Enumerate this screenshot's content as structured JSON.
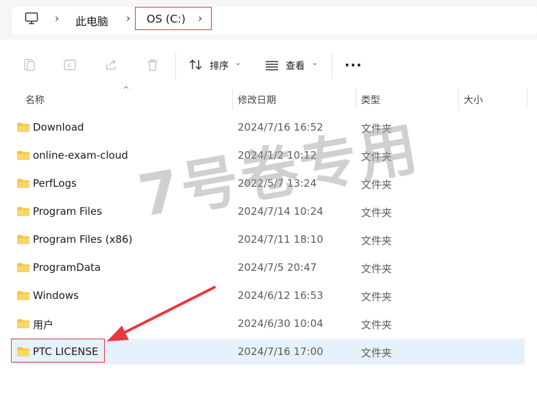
{
  "address_bar": {
    "icon": "computer-icon",
    "crumbs": [
      "此电脑",
      "OS (C:)"
    ],
    "highlight_color": "#d9363e"
  },
  "toolbar": {
    "sort_label": "排序",
    "view_label": "查看",
    "more_label": "..."
  },
  "columns": {
    "name": "名称",
    "date": "修改日期",
    "type": "类型",
    "size": "大小"
  },
  "rows": [
    {
      "name": "Download",
      "date": "2024/7/16 16:52",
      "type": "文件夹"
    },
    {
      "name": "online-exam-cloud",
      "date": "2024/1/2 10:12",
      "type": "文件夹"
    },
    {
      "name": "PerfLogs",
      "date": "2022/5/7 13:24",
      "type": "文件夹"
    },
    {
      "name": "Program Files",
      "date": "2024/7/14 10:24",
      "type": "文件夹"
    },
    {
      "name": "Program Files (x86)",
      "date": "2024/7/11 18:10",
      "type": "文件夹"
    },
    {
      "name": "ProgramData",
      "date": "2024/7/5 20:47",
      "type": "文件夹"
    },
    {
      "name": "Windows",
      "date": "2024/6/12 16:53",
      "type": "文件夹"
    },
    {
      "name": "用户",
      "date": "2024/6/30 10:04",
      "type": "文件夹"
    },
    {
      "name": "PTC LICENSE",
      "date": "2024/7/16 17:00",
      "type": "文件夹",
      "selected": true
    }
  ],
  "watermark": "7号卷专用",
  "colors": {
    "annotation": "#e8383d",
    "selection": "#e5f1fb",
    "folder": "#f5c441"
  }
}
